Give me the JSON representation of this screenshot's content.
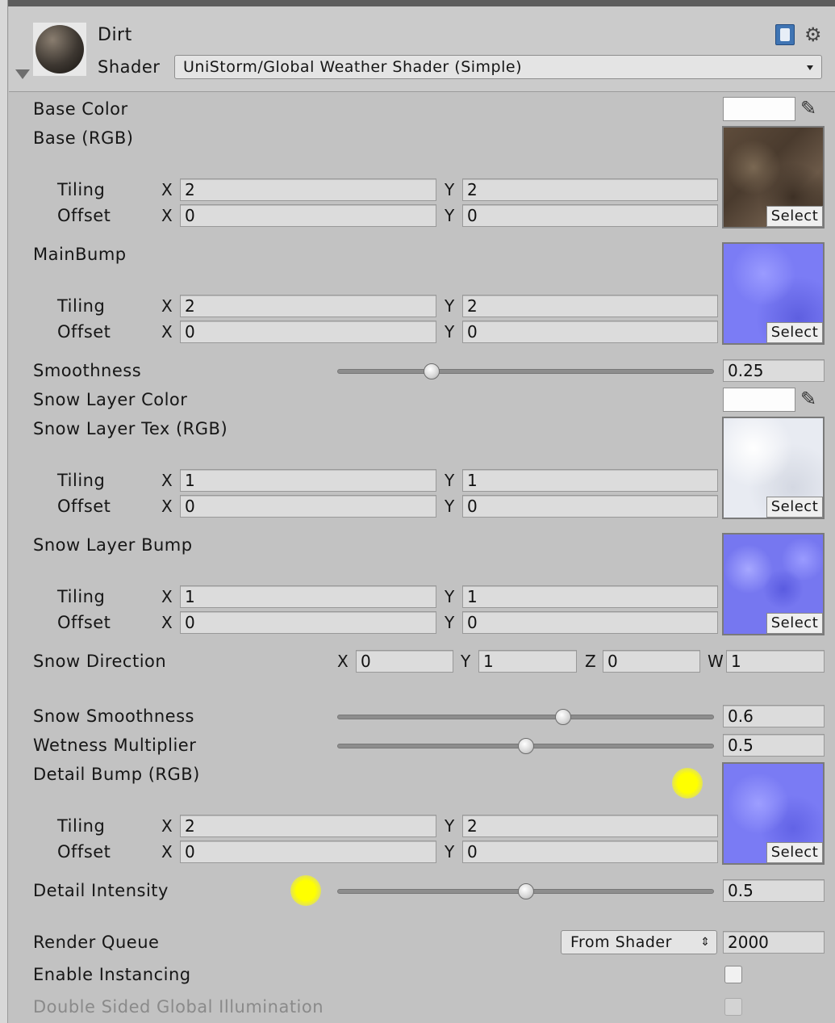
{
  "header": {
    "material_name": "Dirt",
    "shader_label": "Shader",
    "shader_value": "UniStorm/Global Weather Shader (Simple)"
  },
  "properties": {
    "base_color": "Base Color",
    "base_rgb": "Base (RGB)",
    "main_bump": "MainBump",
    "smoothness": "Smoothness",
    "snow_layer_color": "Snow Layer Color",
    "snow_layer_tex": "Snow Layer Tex (RGB)",
    "snow_layer_bump": "Snow Layer Bump",
    "snow_direction": "Snow Direction",
    "snow_smoothness": "Snow Smoothness",
    "wetness_multiplier": "Wetness Multiplier",
    "detail_bump": "Detail Bump (RGB)",
    "detail_intensity": "Detail Intensity",
    "render_queue": "Render Queue",
    "enable_instancing": "Enable Instancing",
    "double_sided_gi": "Double Sided Global Illumination"
  },
  "common": {
    "tiling": "Tiling",
    "offset": "Offset",
    "x": "X",
    "y": "Y",
    "z": "Z",
    "w": "W",
    "select": "Select"
  },
  "textures": {
    "base": {
      "tiling_x": "2",
      "tiling_y": "2",
      "offset_x": "0",
      "offset_y": "0"
    },
    "main_bump": {
      "tiling_x": "2",
      "tiling_y": "2",
      "offset_x": "0",
      "offset_y": "0"
    },
    "snow_tex": {
      "tiling_x": "1",
      "tiling_y": "1",
      "offset_x": "0",
      "offset_y": "0"
    },
    "snow_bump": {
      "tiling_x": "1",
      "tiling_y": "1",
      "offset_x": "0",
      "offset_y": "0"
    },
    "detail_bump": {
      "tiling_x": "2",
      "tiling_y": "2",
      "offset_x": "0",
      "offset_y": "0"
    }
  },
  "values": {
    "smoothness": "0.25",
    "snow_dir_x": "0",
    "snow_dir_y": "1",
    "snow_dir_z": "0",
    "snow_dir_w": "1",
    "snow_smoothness": "0.6",
    "wetness_multiplier": "0.5",
    "detail_intensity": "0.5",
    "render_queue_mode": "From Shader",
    "render_queue_value": "2000"
  },
  "slider_levels": {
    "smoothness": 0.25,
    "snow_smoothness": 0.6,
    "wetness_multiplier": 0.5,
    "detail_intensity": 0.5
  },
  "colors": {
    "panel_bg": "#c2c2c2",
    "bump_blue": "#7b7cf5",
    "highlight": "#ffff00"
  }
}
